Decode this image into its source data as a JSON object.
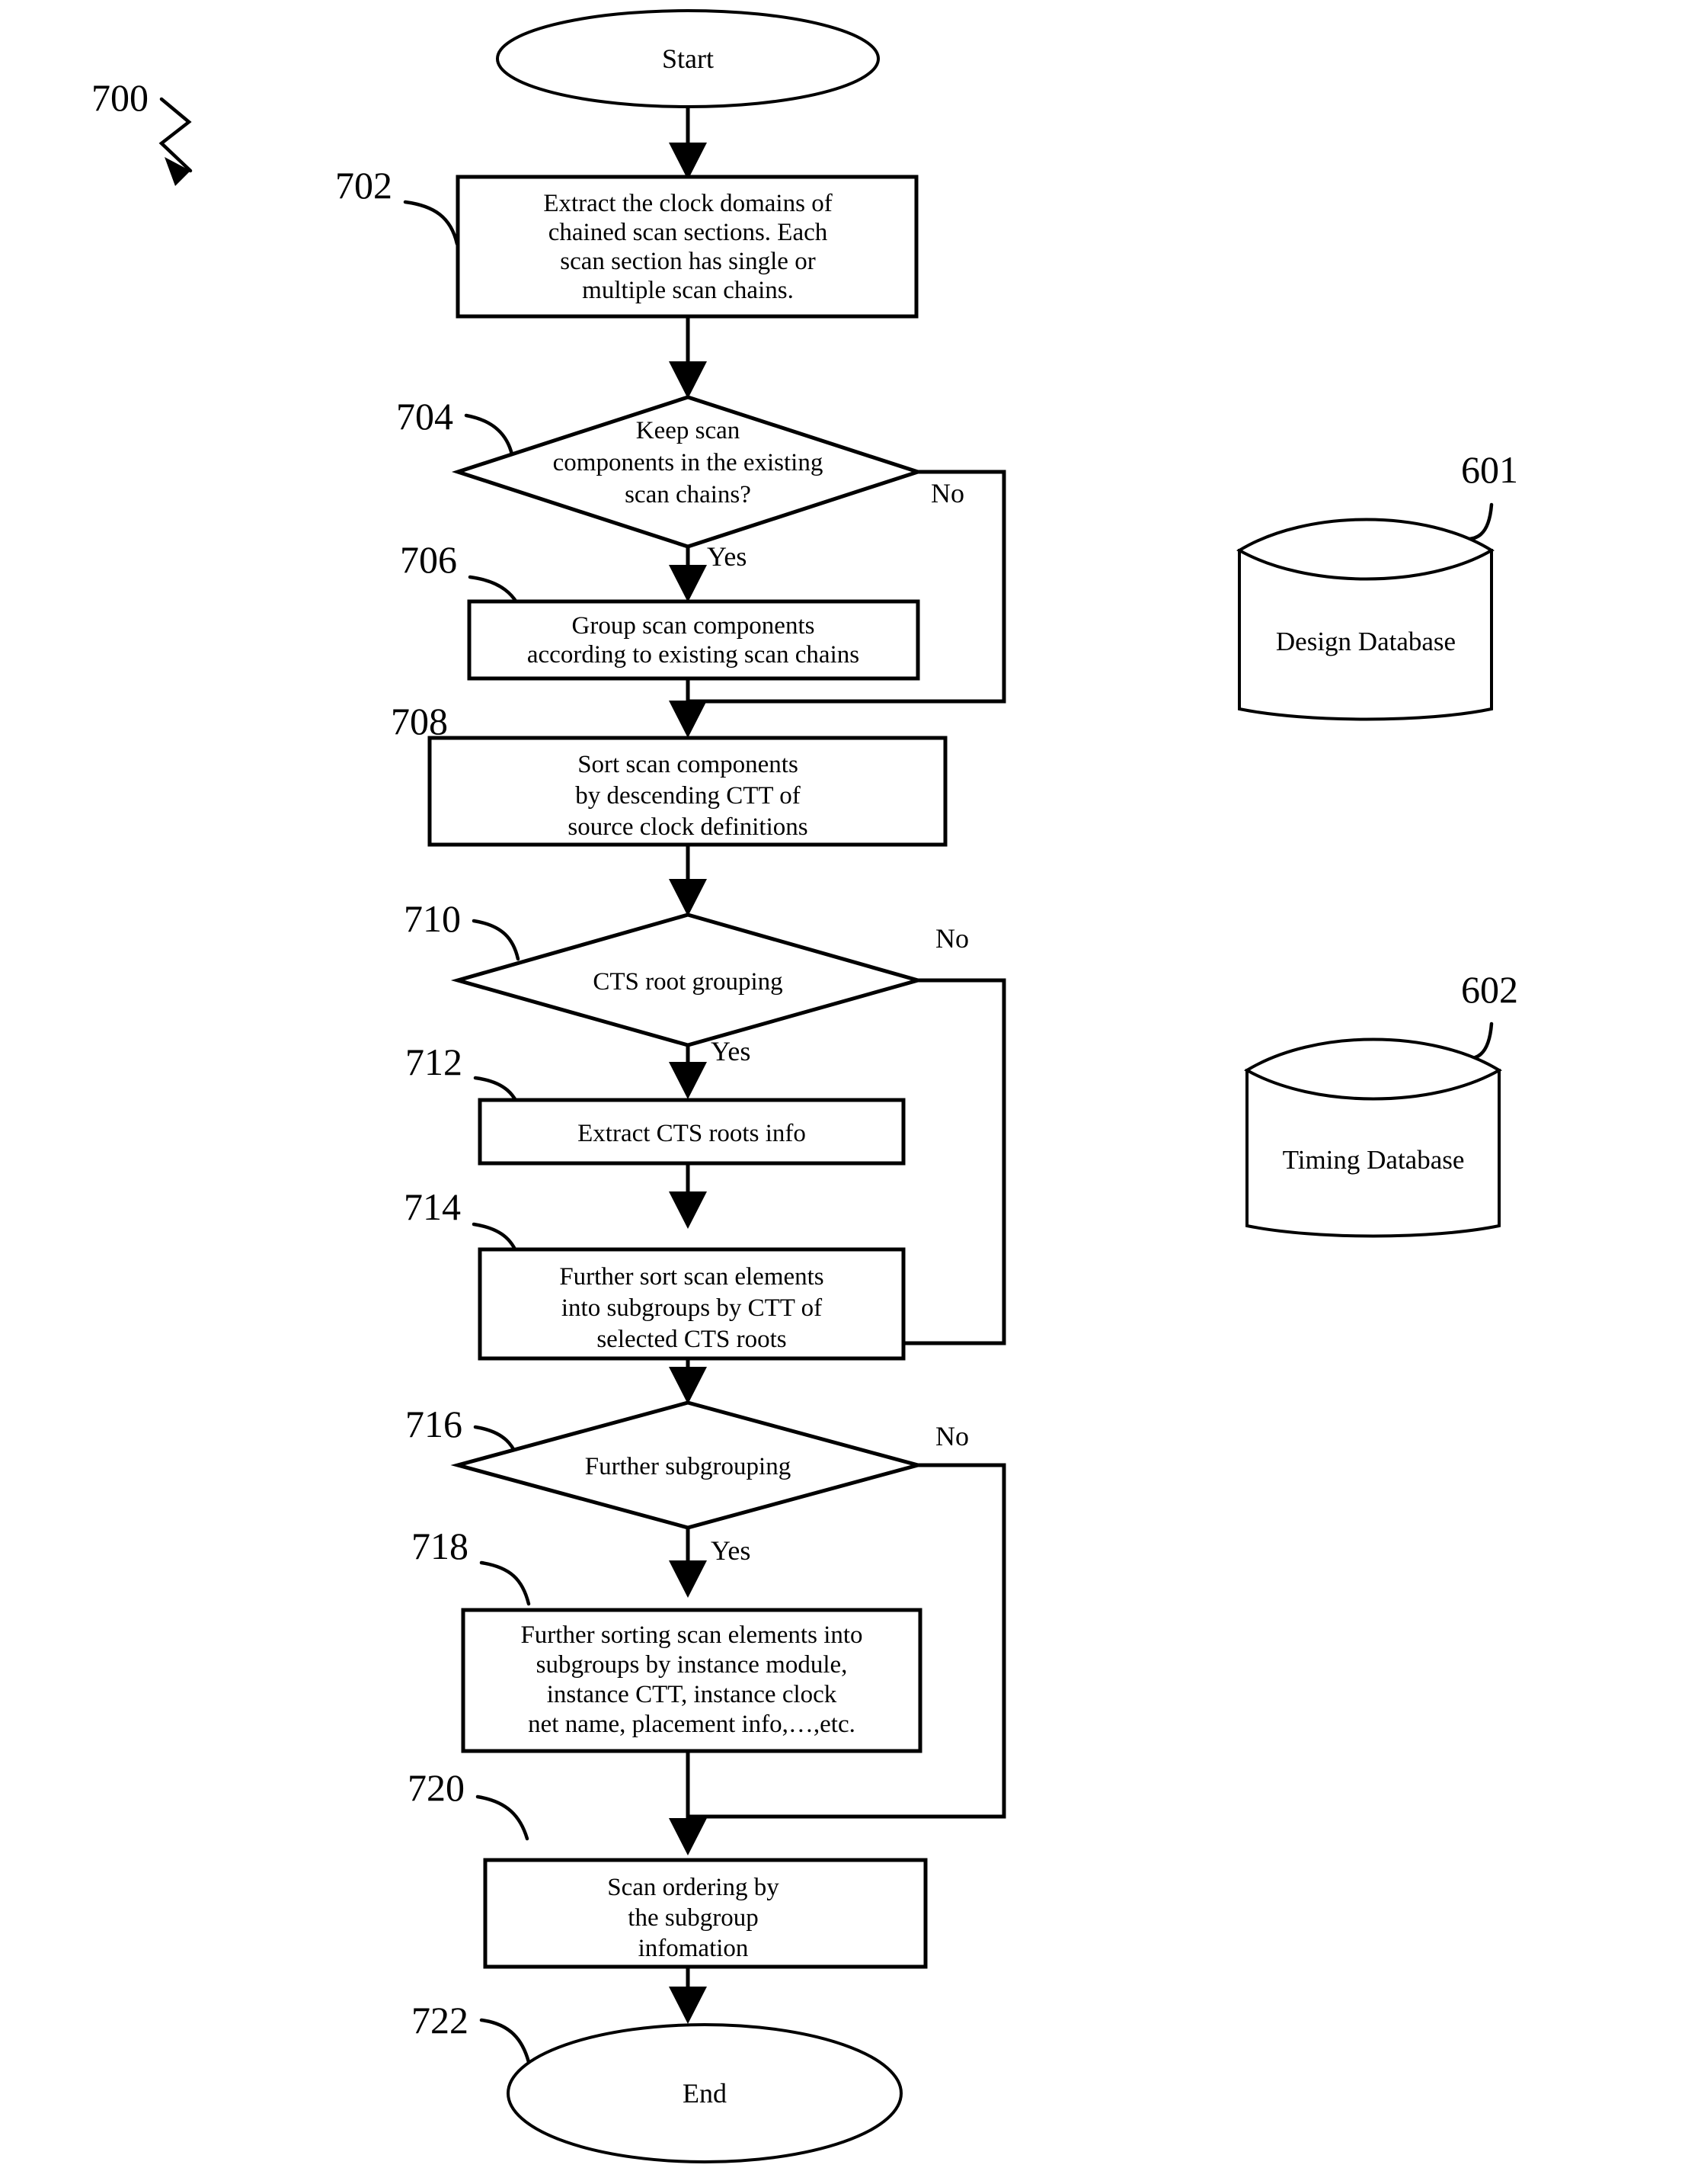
{
  "figure": {
    "figure_ref": "700",
    "terminators": {
      "start": {
        "label": "Start"
      },
      "end": {
        "label": "End",
        "ref": "722"
      }
    },
    "nodes": [
      {
        "ref": "702",
        "type": "process",
        "lines": [
          "Extract the clock domains of",
          "chained scan sections. Each",
          "scan section has single or",
          "multiple scan chains."
        ]
      },
      {
        "ref": "704",
        "type": "decision",
        "lines": [
          "Keep scan",
          "components in the existing",
          "scan chains?"
        ],
        "yes_label": "Yes",
        "no_label": "No"
      },
      {
        "ref": "706",
        "type": "process",
        "lines": [
          "Group scan components",
          "according to existing scan chains"
        ]
      },
      {
        "ref": "708",
        "type": "process",
        "lines": [
          "Sort scan components",
          "by descending CTT of",
          "source clock definitions"
        ]
      },
      {
        "ref": "710",
        "type": "decision",
        "lines": [
          "CTS root grouping"
        ],
        "yes_label": "Yes",
        "no_label": "No"
      },
      {
        "ref": "712",
        "type": "process",
        "lines": [
          "Extract CTS roots info"
        ]
      },
      {
        "ref": "714",
        "type": "process",
        "lines": [
          "Further sort scan elements",
          "into subgroups by CTT of",
          "selected CTS roots"
        ]
      },
      {
        "ref": "716",
        "type": "decision",
        "lines": [
          "Further subgrouping"
        ],
        "yes_label": "Yes",
        "no_label": "No"
      },
      {
        "ref": "718",
        "type": "process",
        "lines": [
          "Further sorting scan elements into",
          "subgroups by instance module,",
          "instance CTT, instance clock",
          "net name, placement info,…,etc."
        ]
      },
      {
        "ref": "720",
        "type": "process",
        "lines": [
          "Scan ordering by",
          "the subgroup",
          "infomation"
        ]
      }
    ],
    "databases": [
      {
        "ref": "601",
        "label": "Design Database"
      },
      {
        "ref": "602",
        "label": "Timing Database"
      }
    ]
  }
}
